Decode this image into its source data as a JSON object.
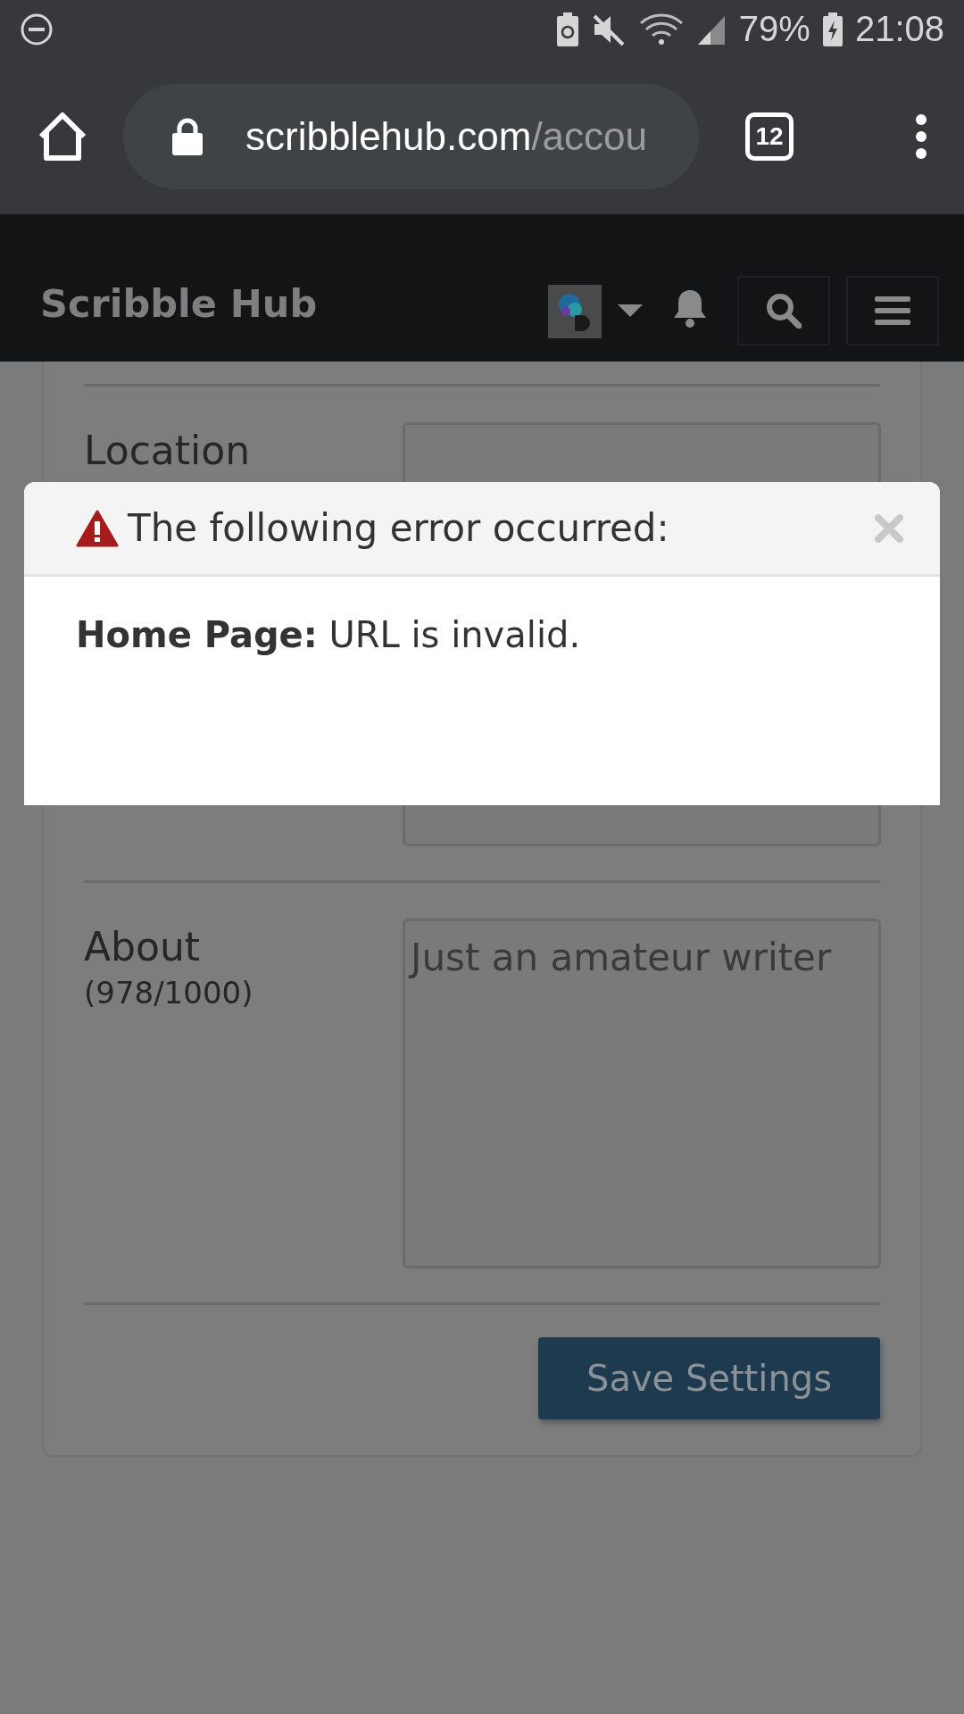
{
  "status_bar": {
    "battery": "79%",
    "time": "21:08"
  },
  "browser": {
    "url_host": "scribblehub.com",
    "url_path": "/accou",
    "tab_count": "12"
  },
  "site_header": {
    "title": "Scribble Hub"
  },
  "form": {
    "rows": [
      {
        "kind": "input",
        "label": "Location"
      },
      {
        "kind": "input"
      },
      {
        "kind": "textarea",
        "label": "About",
        "count": "(978/1000)",
        "value": "Just an amateur writer"
      }
    ],
    "save_button": "Save Settings"
  },
  "modal": {
    "title": "The following error occurred:",
    "message": "**Home Page:** URL is invalid."
  }
}
